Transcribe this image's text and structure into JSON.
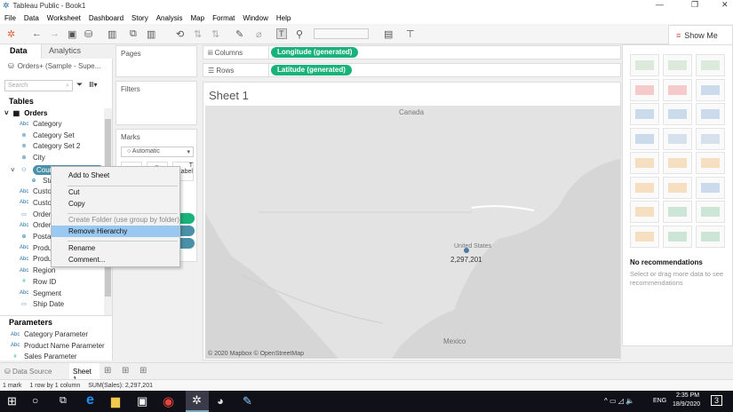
{
  "window": {
    "title": "Tableau Public - Book1",
    "minimize": "—",
    "maximize": "❐",
    "close": "✕"
  },
  "menu": [
    "File",
    "Data",
    "Worksheet",
    "Dashboard",
    "Story",
    "Analysis",
    "Map",
    "Format",
    "Window",
    "Help"
  ],
  "toolbar": {
    "show_me": "Show Me"
  },
  "left_panel": {
    "tabs": [
      "Data",
      "Analytics"
    ],
    "datasource": "Orders+ (Sample - Supe...",
    "search_placeholder": "Search",
    "tables_heading": "Tables",
    "table_name": "Orders",
    "fields": [
      {
        "icon": "Abc",
        "label": "Category"
      },
      {
        "icon": "set",
        "label": "Category Set"
      },
      {
        "icon": "set",
        "label": "Category Set 2"
      },
      {
        "icon": "globe",
        "label": "City"
      },
      {
        "icon": "hierarchy",
        "label": "Country"
      },
      {
        "icon": "globe",
        "label": "State"
      },
      {
        "icon": "Abc",
        "label": "Custo"
      },
      {
        "icon": "Abc",
        "label": "Custo"
      },
      {
        "icon": "date",
        "label": "Order"
      },
      {
        "icon": "Abc",
        "label": "Order"
      },
      {
        "icon": "globe",
        "label": "Posta"
      },
      {
        "icon": "Abc",
        "label": "Produ"
      },
      {
        "icon": "Abc",
        "label": "Produ"
      },
      {
        "icon": "Abc",
        "label": "Region"
      },
      {
        "icon": "#",
        "label": "Row ID"
      },
      {
        "icon": "Abc",
        "label": "Segment"
      },
      {
        "icon": "date",
        "label": "Ship Date"
      }
    ],
    "parameters_heading": "Parameters",
    "parameters": [
      {
        "icon": "Abc",
        "label": "Category Parameter"
      },
      {
        "icon": "Abc",
        "label": "Product Name Parameter"
      },
      {
        "icon": "#",
        "label": "Sales Parameter"
      }
    ]
  },
  "shelves": {
    "pages": "Pages",
    "filters": "Filters",
    "marks": "Marks",
    "mark_type": "Automatic",
    "label_card": "Label",
    "columns": "Columns",
    "rows": "Rows",
    "columns_pill": "Longitude (generated)",
    "rows_pill": "Latitude (generated)"
  },
  "context_menu": {
    "items": [
      "Add to Sheet",
      "Cut",
      "Copy",
      "Create Folder (use group by folder)",
      "Remove Hierarchy",
      "Rename",
      "Comment..."
    ],
    "highlighted": "Remove Hierarchy",
    "disabled": [
      "Create Folder (use group by folder)"
    ]
  },
  "sheet": {
    "title": "Sheet 1",
    "labels": {
      "canada": "Canada",
      "us": "United States",
      "value": "2,297,201",
      "mexico": "Mexico"
    },
    "attribution": "© 2020 Mapbox © OpenStreetMap"
  },
  "show_me": {
    "no_rec_title": "No recommendations",
    "no_rec_text": "Select or drag more data to see recommendations"
  },
  "bottom_tabs": {
    "data_source": "Data Source",
    "sheet": "Sheet 1"
  },
  "status": {
    "marks": "1 mark",
    "rows": "1 row by 1 column",
    "sum": "SUM(Sales): 2,297,201"
  },
  "taskbar": {
    "lang": "ENG",
    "time": "2:35 PM",
    "date": "18/9/2020",
    "notifications": "3"
  },
  "colors": {
    "pill_green": "#19b27a",
    "pill_blue": "#4a90a8",
    "highlight": "#99c9f0",
    "map_bg": "#d9d9d9"
  }
}
